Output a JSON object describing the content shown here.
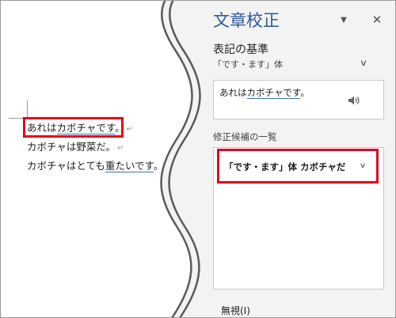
{
  "document": {
    "line1": {
      "prefix": "あれは",
      "underlined": "カボチャです",
      "suffix": "。"
    },
    "line2": {
      "text": "カボチャは野菜だ。"
    },
    "line3": {
      "prefix": "カボチャはとても",
      "underlined": "重たいです",
      "suffix": "。"
    },
    "paragraph_mark": "↵"
  },
  "pane": {
    "title": "文章校正",
    "menu_icon": "▼",
    "close_icon": "✕",
    "section_heading": "表記の基準",
    "section_value": "「です・ます」体",
    "section_chevron": "∨",
    "preview": {
      "prefix": "あれは",
      "underlined": "カボチャです",
      "suffix": "。"
    },
    "list_heading": "修正候補の一覧",
    "suggestion": {
      "label": "「です・ます」体 カボチャだ",
      "chevron": "∨"
    },
    "ignore": "無視(I)"
  },
  "colors": {
    "accent_title": "#2b579a",
    "highlight_red": "#e4001b",
    "underline_blue": "#3d6fb5",
    "pane_background": "#f3f3f3"
  }
}
